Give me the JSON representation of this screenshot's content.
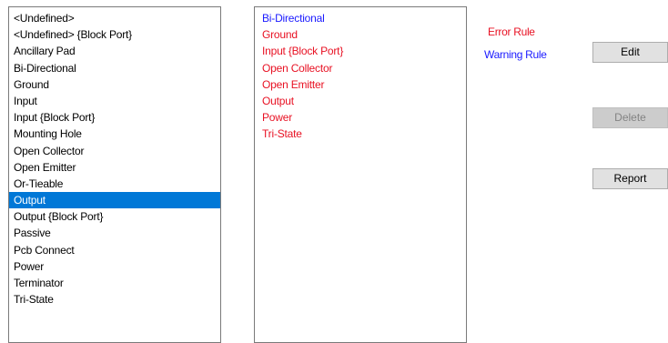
{
  "pin_types": {
    "items": [
      {
        "label": "<Undefined>",
        "selected": false
      },
      {
        "label": "<Undefined> {Block Port}",
        "selected": false
      },
      {
        "label": "Ancillary Pad",
        "selected": false
      },
      {
        "label": "Bi-Directional",
        "selected": false
      },
      {
        "label": "Ground",
        "selected": false
      },
      {
        "label": "Input",
        "selected": false
      },
      {
        "label": "Input {Block Port}",
        "selected": false
      },
      {
        "label": "Mounting Hole",
        "selected": false
      },
      {
        "label": "Open Collector",
        "selected": false
      },
      {
        "label": "Open Emitter",
        "selected": false
      },
      {
        "label": "Or-Tieable",
        "selected": false
      },
      {
        "label": "Output",
        "selected": true
      },
      {
        "label": "Output {Block Port}",
        "selected": false
      },
      {
        "label": "Passive",
        "selected": false
      },
      {
        "label": "Pcb Connect",
        "selected": false
      },
      {
        "label": "Power",
        "selected": false
      },
      {
        "label": "Terminator",
        "selected": false
      },
      {
        "label": "Tri-State",
        "selected": false
      }
    ]
  },
  "rules": {
    "items": [
      {
        "label": "Bi-Directional",
        "kind": "warning"
      },
      {
        "label": "Ground",
        "kind": "error"
      },
      {
        "label": "Input {Block Port}",
        "kind": "error"
      },
      {
        "label": "Open Collector",
        "kind": "error"
      },
      {
        "label": "Open Emitter",
        "kind": "error"
      },
      {
        "label": "Output",
        "kind": "error"
      },
      {
        "label": "Power",
        "kind": "error"
      },
      {
        "label": "Tri-State",
        "kind": "error"
      }
    ]
  },
  "legend": {
    "error_label": "Error Rule",
    "warning_label": "Warning Rule"
  },
  "buttons": {
    "edit_label": "Edit",
    "delete_label": "Delete",
    "delete_enabled": false,
    "report_label": "Report"
  },
  "colors": {
    "error": "#e81123",
    "warning": "#1a1aff",
    "selection": "#0078d7"
  }
}
